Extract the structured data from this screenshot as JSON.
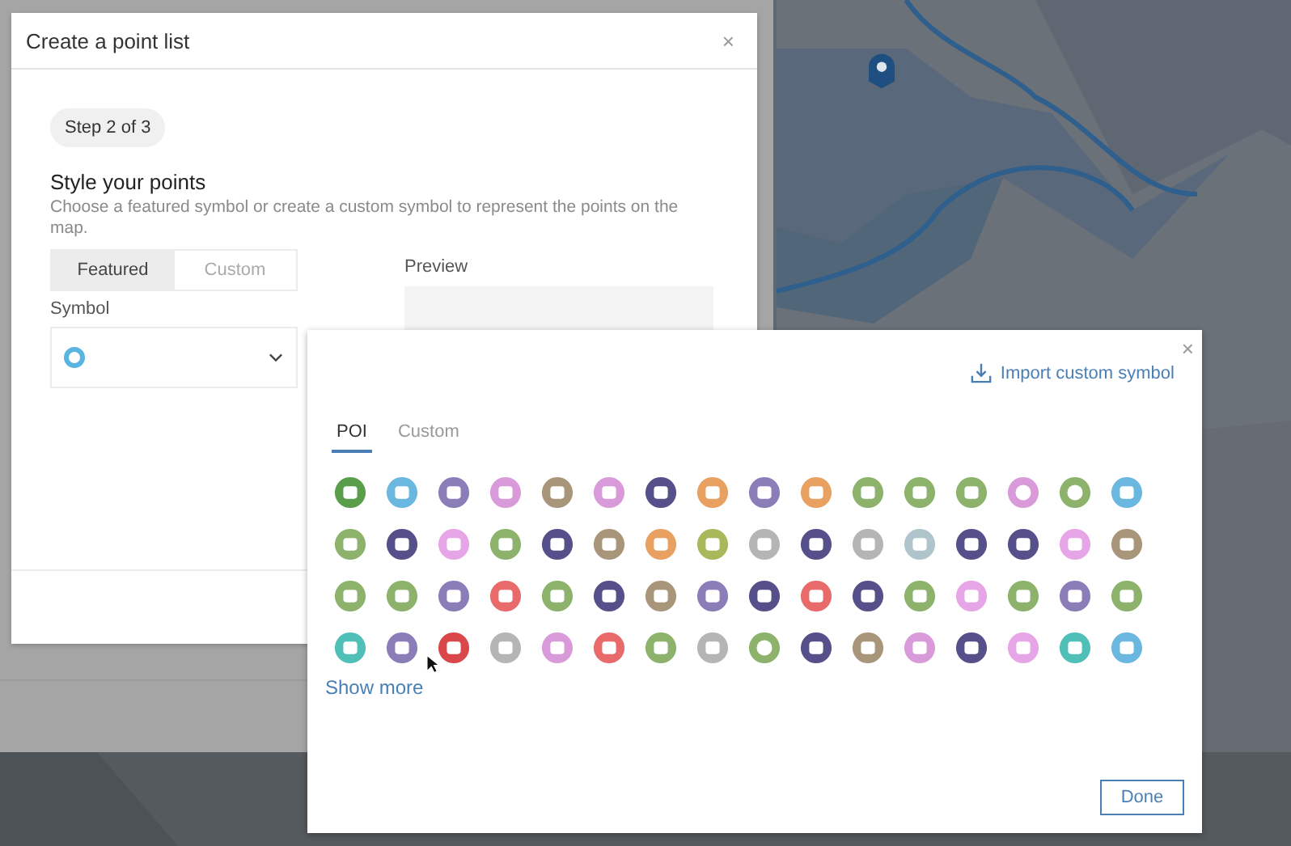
{
  "dialog": {
    "title": "Create a point list",
    "close": "×",
    "step": "Step 2 of 3",
    "heading": "Style your points",
    "description": "Choose a featured symbol or create a custom symbol to represent the points on the map.",
    "modes": [
      {
        "label": "Featured",
        "selected": true
      },
      {
        "label": "Custom",
        "selected": false
      }
    ],
    "preview_label": "Preview",
    "symbol_label": "Symbol"
  },
  "symbol_picker": {
    "close": "×",
    "import_link": "Import custom symbol",
    "tabs": [
      {
        "label": "POI",
        "selected": true
      },
      {
        "label": "Custom",
        "selected": false
      }
    ],
    "symbols": [
      {
        "kind": "glyph",
        "color": "#5a9e4c"
      },
      {
        "kind": "glyph",
        "color": "#6ab7e0"
      },
      {
        "kind": "glyph",
        "color": "#8a7db8"
      },
      {
        "kind": "glyph",
        "color": "#d99ad9"
      },
      {
        "kind": "glyph",
        "color": "#a8957a"
      },
      {
        "kind": "glyph",
        "color": "#d99ad9"
      },
      {
        "kind": "glyph",
        "color": "#56508a"
      },
      {
        "kind": "glyph",
        "color": "#e8a160"
      },
      {
        "kind": "glyph",
        "color": "#8a7db8"
      },
      {
        "kind": "glyph",
        "color": "#e8a160"
      },
      {
        "kind": "glyph",
        "color": "#8db26b"
      },
      {
        "kind": "glyph",
        "color": "#8db26b"
      },
      {
        "kind": "glyph",
        "color": "#8db26b"
      },
      {
        "kind": "ring",
        "color": "#d99ad9"
      },
      {
        "kind": "ring",
        "color": "#8db26b"
      },
      {
        "kind": "glyph",
        "color": "#6ab7e0"
      },
      {
        "kind": "glyph",
        "color": "#8db26b"
      },
      {
        "kind": "glyph",
        "color": "#56508a"
      },
      {
        "kind": "glyph",
        "color": "#e6a5e6"
      },
      {
        "kind": "glyph",
        "color": "#8db26b"
      },
      {
        "kind": "glyph",
        "color": "#56508a"
      },
      {
        "kind": "glyph",
        "color": "#a8957a"
      },
      {
        "kind": "glyph",
        "color": "#e8a160"
      },
      {
        "kind": "glyph",
        "color": "#a8b85a"
      },
      {
        "kind": "glyph",
        "color": "#b5b5b5"
      },
      {
        "kind": "glyph",
        "color": "#56508a"
      },
      {
        "kind": "glyph",
        "color": "#b5b5b5"
      },
      {
        "kind": "glyph",
        "color": "#b0c4cc"
      },
      {
        "kind": "glyph",
        "color": "#56508a"
      },
      {
        "kind": "glyph",
        "color": "#56508a"
      },
      {
        "kind": "glyph",
        "color": "#e6a5e6"
      },
      {
        "kind": "glyph",
        "color": "#a8957a"
      },
      {
        "kind": "glyph",
        "color": "#8db26b"
      },
      {
        "kind": "glyph",
        "color": "#8db26b"
      },
      {
        "kind": "glyph",
        "color": "#8a7db8"
      },
      {
        "kind": "glyph",
        "color": "#e86a6a"
      },
      {
        "kind": "glyph",
        "color": "#8db26b"
      },
      {
        "kind": "glyph",
        "color": "#56508a"
      },
      {
        "kind": "glyph",
        "color": "#a8957a"
      },
      {
        "kind": "glyph",
        "color": "#8a7db8"
      },
      {
        "kind": "glyph",
        "color": "#56508a"
      },
      {
        "kind": "glyph",
        "color": "#e86a6a"
      },
      {
        "kind": "glyph",
        "color": "#56508a"
      },
      {
        "kind": "glyph",
        "color": "#8db26b"
      },
      {
        "kind": "glyph",
        "color": "#e6a5e6"
      },
      {
        "kind": "glyph",
        "color": "#8db26b"
      },
      {
        "kind": "glyph",
        "color": "#8a7db8"
      },
      {
        "kind": "glyph",
        "color": "#8db26b"
      },
      {
        "kind": "glyph",
        "color": "#4fbfb8"
      },
      {
        "kind": "glyph",
        "color": "#8a7db8"
      },
      {
        "kind": "glyph",
        "color": "#d9474a"
      },
      {
        "kind": "glyph",
        "color": "#b5b5b5"
      },
      {
        "kind": "glyph",
        "color": "#d99ad9"
      },
      {
        "kind": "glyph",
        "color": "#e86a6a"
      },
      {
        "kind": "glyph",
        "color": "#8db26b"
      },
      {
        "kind": "glyph",
        "color": "#b5b5b5"
      },
      {
        "kind": "ring",
        "color": "#8db26b"
      },
      {
        "kind": "glyph",
        "color": "#56508a"
      },
      {
        "kind": "glyph",
        "color": "#a8957a"
      },
      {
        "kind": "glyph",
        "color": "#d99ad9"
      },
      {
        "kind": "glyph",
        "color": "#56508a"
      },
      {
        "kind": "glyph",
        "color": "#e6a5e6"
      },
      {
        "kind": "glyph",
        "color": "#4fbfb8"
      },
      {
        "kind": "glyph",
        "color": "#6ab7e0"
      }
    ],
    "show_more": "Show more",
    "done": "Done"
  }
}
